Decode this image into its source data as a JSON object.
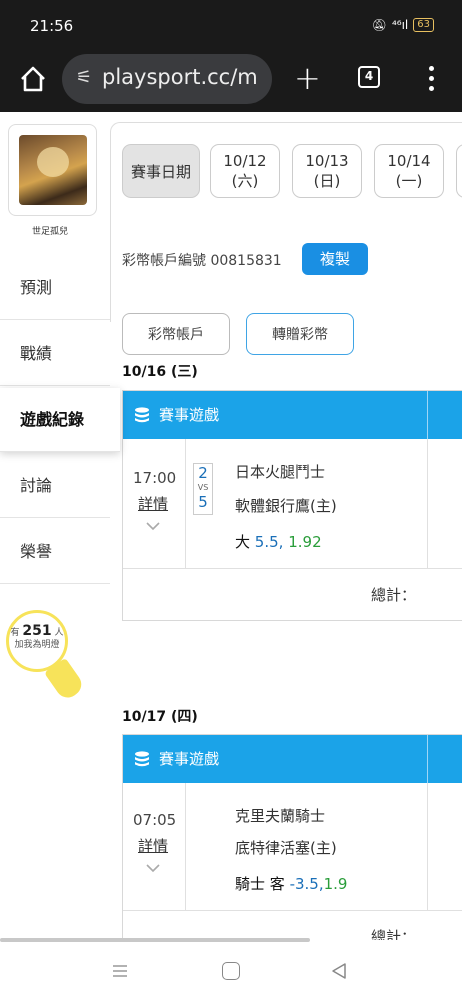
{
  "status": {
    "time": "21:56",
    "signal": "⁴⁶ıl",
    "battery": "63"
  },
  "browser": {
    "url": "playsport.cc/m",
    "tab_count": "4"
  },
  "sidebar": {
    "username": "世足孤兒",
    "items": [
      {
        "label": "預測"
      },
      {
        "label": "戰績"
      },
      {
        "label": "遊戲紀錄"
      },
      {
        "label": "討論"
      },
      {
        "label": "榮譽"
      }
    ],
    "bulb": {
      "prefix": "有",
      "count": "251",
      "suffix": "人",
      "line2": "加我為明燈"
    }
  },
  "dates": {
    "label": "賽事日期",
    "items": [
      {
        "date": "10/12",
        "weekday": "(六)"
      },
      {
        "date": "10/13",
        "weekday": "(日)"
      },
      {
        "date": "10/14",
        "weekday": "(一)"
      }
    ]
  },
  "account": {
    "text": "彩幣帳戶編號 00815831",
    "copy_label": "複製",
    "btn_account": "彩幣帳戶",
    "btn_transfer": "轉贈彩幣"
  },
  "days": [
    {
      "label": "10/16 (三)",
      "header": "賽事遊戲",
      "time": "17:00",
      "detail": "詳情",
      "score_home": "2",
      "vs": "VS",
      "score_away": "5",
      "team1": "日本火腿鬥士",
      "team2": "軟體銀行鷹(主)",
      "pick_text": "大",
      "pick_line": "5.5",
      "pick_sep": ",",
      "pick_odds": "1.92",
      "total": "總計："
    },
    {
      "label": "10/17 (四)",
      "header": "賽事遊戲",
      "time": "07:05",
      "detail": "詳情",
      "team1": "克里夫蘭騎士",
      "team2": "底特律活塞(主)",
      "pick_text": "騎士 客",
      "pick_line": "-3.5",
      "pick_sep": ",",
      "pick_odds": "1.9",
      "total": "總計："
    }
  ]
}
